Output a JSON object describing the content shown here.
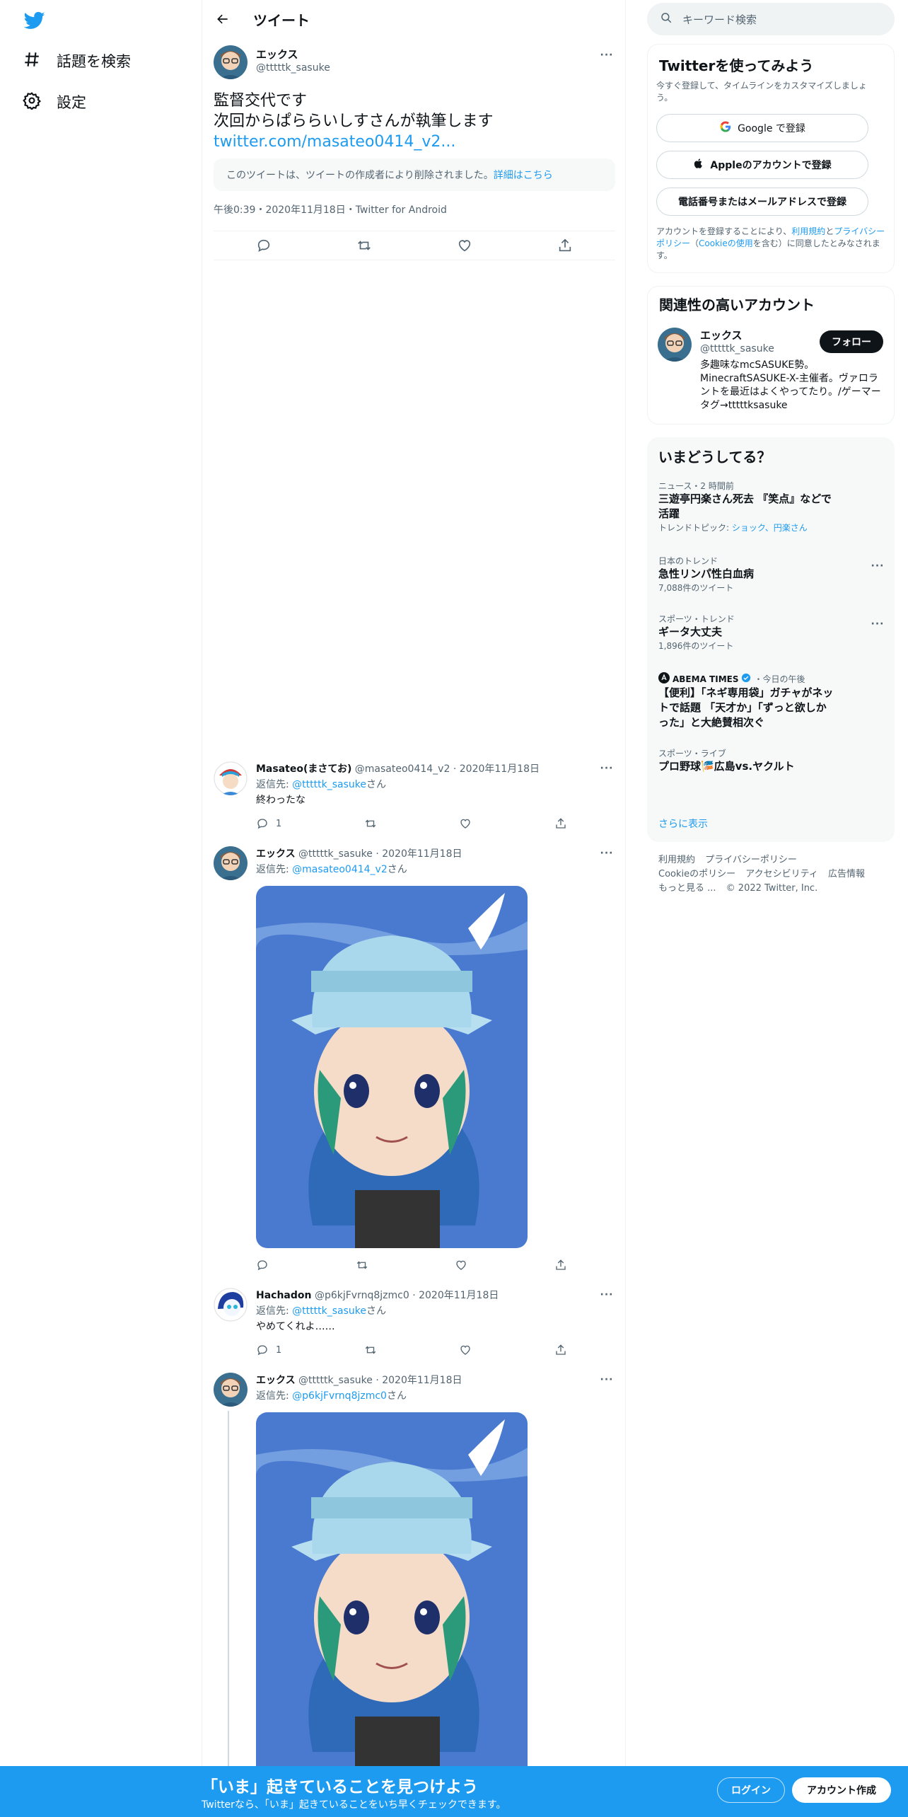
{
  "nav": {
    "explore_label": "話題を検索",
    "settings_label": "設定"
  },
  "header": {
    "title": "ツイート"
  },
  "main_tweet": {
    "name": "エックス",
    "handle": "@tttttk_sasuke",
    "lines": [
      "監督交代です",
      "次回からぱららいしすさんが執筆します"
    ],
    "link": "twitter.com/masateo0414_v2...",
    "deleted_notice": "このツイートは、ツイートの作成者により削除されました。",
    "deleted_link": "詳細はこちら",
    "meta": "午後0:39・2020年11月18日・Twitter for Android"
  },
  "replies": [
    {
      "name": "Masateo(まさてお)",
      "handle": "@masateo0414_v2",
      "date": "2020年11月18日",
      "reply_to_prefix": "返信先: ",
      "reply_to": "@tttttk_sasuke",
      "reply_to_suffix": "さん",
      "text": "終わったな",
      "reply_count": "1"
    },
    {
      "name": "エックス",
      "handle": "@tttttk_sasuke",
      "date": "2020年11月18日",
      "reply_to_prefix": "返信先: ",
      "reply_to": "@masateo0414_v2",
      "reply_to_suffix": "さん"
    },
    {
      "name": "Hachadon",
      "handle": "@p6kjFvrnq8jzmc0",
      "date": "2020年11月18日",
      "reply_to_prefix": "返信先: ",
      "reply_to": "@tttttk_sasuke",
      "reply_to_suffix": "さん",
      "text": "やめてくれよ……",
      "reply_count": "1"
    },
    {
      "name": "エックス",
      "handle": "@tttttk_sasuke",
      "date": "2020年11月18日",
      "reply_to_prefix": "返信先: ",
      "reply_to": "@p6kjFvrnq8jzmc0",
      "reply_to_suffix": "さん"
    }
  ],
  "sidebar": {
    "search_placeholder": "キーワード検索",
    "signup": {
      "title": "Twitterを使ってみよう",
      "subtitle": "今すぐ登録して、タイムラインをカスタマイズしましょう。",
      "google_label": "Google で登録",
      "apple_label": "Appleのアカウントで登録",
      "phone_label": "電話番号またはメールアドレスで登録",
      "terms_prefix": "アカウントを登録することにより、",
      "terms_link": "利用規約",
      "terms_and": "と",
      "privacy_link": "プライバシーポリシー",
      "cookie_open": "（",
      "cookie_link": "Cookieの使用",
      "cookie_close": "を含む）に同意したとみなされます。"
    },
    "related": {
      "title": "関連性の高いアカウント",
      "name": "エックス",
      "handle": "@tttttk_sasuke",
      "follow_label": "フォロー",
      "bio": "多趣味なmcSASUKE勢。MinecraftSASUKE-X-主催者。ヴァロラントを最近はよくやってたり。/ゲーマータグ→tttttksasuke"
    },
    "trends": {
      "title": "いまどうしてる？",
      "items": [
        {
          "category": "ニュース・2 時間前",
          "title": "三遊亭円楽さん死去 『笑点』などで活躍",
          "topic_prefix": "トレンドトピック: ",
          "topic_links": "ショック、円楽さん"
        },
        {
          "category": "日本のトレンド",
          "title": "急性リンパ性白血病",
          "count": "7,088件のツイート"
        },
        {
          "category": "スポーツ・トレンド",
          "title": "ギータ大丈夫",
          "count": "1,896件のツイート"
        },
        {
          "category": "ABEMA TIMES",
          "category_suffix": "・今日の午後",
          "title": "【便利】「ネギ専用袋」ガチャがネットで話題 「天才か」「ずっと欲しかった」と大絶賛相次ぐ"
        },
        {
          "category": "スポーツ・ライブ",
          "title": "プロ野球🎏広島vs.ヤクルト"
        }
      ],
      "show_more": "さらに表示"
    },
    "footer": {
      "terms": "利用規約",
      "privacy": "プライバシーポリシー",
      "cookie": "Cookieのポリシー",
      "accessibility": "アクセシビリティ",
      "ads": "広告情報",
      "more": "もっと見る ...",
      "copyright": "© 2022 Twitter, Inc."
    }
  },
  "bottombar": {
    "title": "「いま」起きていることを見つけよう",
    "subtitle": "Twitterなら、「いま」起きていることをいち早くチェックできます。",
    "login_label": "ログイン",
    "signup_label": "アカウント作成"
  },
  "colors": {
    "accent": "#1d9bf0",
    "text": "#0f1419",
    "muted": "#536471",
    "border": "#eff3f4"
  }
}
